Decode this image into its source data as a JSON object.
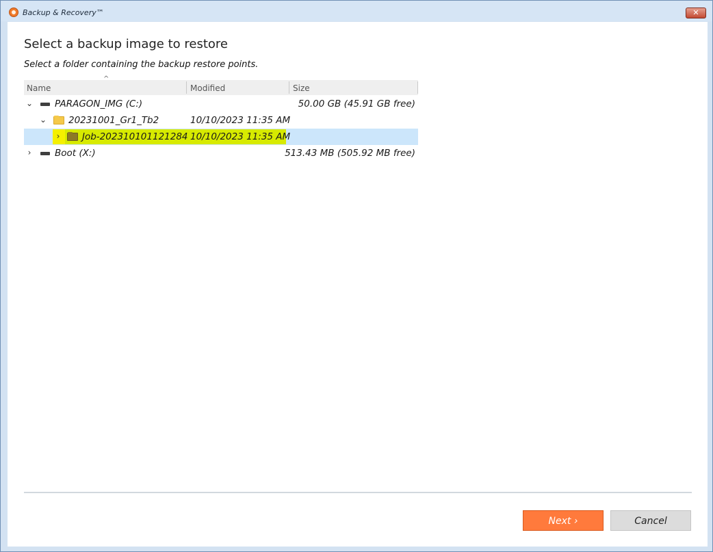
{
  "window": {
    "title": "Backup & Recovery™",
    "close_glyph": "✕",
    "app_icon": "backup-recovery-logo-icon"
  },
  "page": {
    "heading": "Select a backup image to restore",
    "subheading": "Select a folder containing the backup restore points."
  },
  "tree": {
    "columns": {
      "name": "Name",
      "modified": "Modified",
      "size": "Size",
      "sort_indicator": "^"
    },
    "rows": [
      {
        "expander": "⌄",
        "icon": "drive-icon",
        "name": "PARAGON_IMG (C:)",
        "modified": "",
        "size": "50.00 GB (45.91 GB free)"
      },
      {
        "expander": "⌄",
        "icon": "folder-icon",
        "name": "20231001_Gr1_Tb2",
        "modified": "10/10/2023 11:35 AM",
        "size": ""
      },
      {
        "expander": "›",
        "icon": "folder-icon",
        "name": "Job-202310101121284",
        "modified": "10/10/2023 11:35 AM",
        "size": "",
        "selected": true
      },
      {
        "expander": "›",
        "icon": "drive-icon",
        "name": "Boot (X:)",
        "modified": "",
        "size": "513.43 MB (505.92 MB free)"
      }
    ]
  },
  "buttons": {
    "next": "Next ›",
    "cancel": "Cancel"
  },
  "colors": {
    "accent": "#ff7a3c",
    "selection": "#cce6fb",
    "highlight": "#d7ea00"
  }
}
